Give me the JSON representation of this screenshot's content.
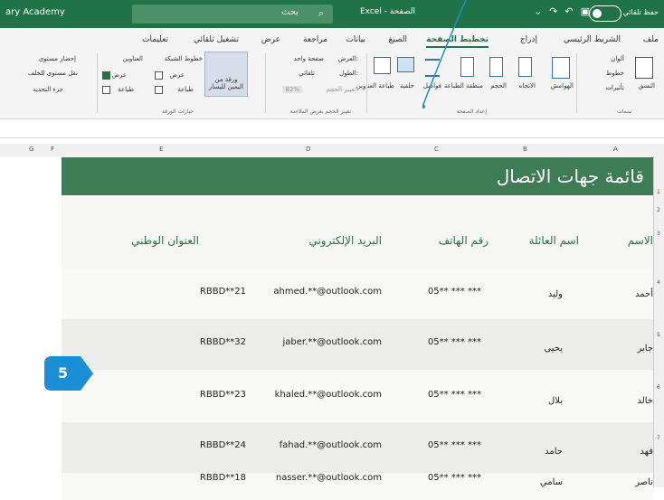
{
  "titlebar": {
    "left_text": "ary Academy",
    "search_text": "بحث",
    "center_text": "Excel  -  الصفحة",
    "autosave_label": "حفظ تلقائي",
    "toggle_state": "on"
  },
  "menu": {
    "tabs": [
      "ملف",
      "الشريط الرئيسي",
      "إدراج",
      "تخطيط الصفحة",
      "الصيغ",
      "بيانات",
      "مراجعة",
      "عرض",
      "تشغيل تلقائي",
      "تعليمات"
    ],
    "active_tab": "تخطيط الصفحة"
  },
  "ribbon": {
    "themes": {
      "label": "سمات",
      "items": [
        "ألوان",
        "خطوط",
        "تأثيرات"
      ],
      "main": "النسق"
    },
    "page_setup": {
      "label": "إعداد الصفحة",
      "buttons": [
        "الهوامش",
        "الاتجاه",
        "الحجم",
        "منطقة الطباعة",
        "فواصل",
        "خلفية",
        "طباعة العناوين"
      ]
    },
    "scale": {
      "label": "تغيير الحجم بغرض الملاءمة",
      "width": "العرض:",
      "width_val": "صفحة واحد",
      "height": "الطول:",
      "height_val": "تلقائي",
      "scale_lbl": "تغيير الحجم:",
      "scale_val": "82%"
    },
    "sheet_options": {
      "label": "خيارات الورقة",
      "gridlines": "خطوط الشبكة",
      "headings": "العناوين",
      "view": "عرض",
      "print": "طباعة"
    },
    "arrange": {
      "sheet_rtl": "ورقة من اليمين لليسار",
      "bring_forward": "إحضار مستوى",
      "send_backward": "نقل مستوى للخلف",
      "selection_pane": "جزء التحديد"
    }
  },
  "columns": [
    "A",
    "B",
    "C",
    "D",
    "E",
    "F",
    "G"
  ],
  "row_numbers": [
    "1",
    "2",
    "3",
    "4",
    "5",
    "6",
    "7"
  ],
  "sheet": {
    "title": "قائمة جهات الاتصال",
    "headers": {
      "name": "الاسم",
      "family": "اسم العائلة",
      "phone": "رقم الهاتف",
      "email": "البريد الإلكتروني",
      "national": "العنوان الوطني"
    },
    "rows": [
      {
        "name": "أحمد",
        "family": "وليد",
        "phone": "05** *** ***",
        "email": "ahmed.**@outlook.com",
        "national": "RBBD**21"
      },
      {
        "name": "جابر",
        "family": "يحيى",
        "phone": "05** *** ***",
        "email": "jaber.**@outlook.com",
        "national": "RBBD**32"
      },
      {
        "name": "خالد",
        "family": "بلال",
        "phone": "05** *** ***",
        "email": "khaled.**@outlook.com",
        "national": "RBBD**23"
      },
      {
        "name": "فهد",
        "family": "حامد",
        "phone": "05** *** ***",
        "email": "fahad.**@outlook.com",
        "national": "RBBD**24"
      },
      {
        "name": "ناصر",
        "family": "سامي",
        "phone": "05** *** ***",
        "email": "nasser.**@outlook.com",
        "national": "RBBD**18"
      }
    ]
  },
  "callout": {
    "number": "5",
    "color": "#1a8fd6"
  },
  "colors": {
    "excel_green": "#1f7346",
    "title_band": "#3e7c55",
    "header_text": "#2f6e47"
  }
}
